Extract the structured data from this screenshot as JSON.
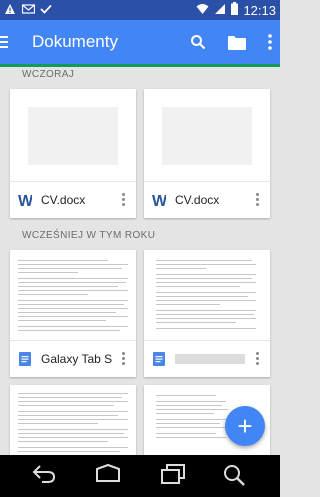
{
  "status_bar": {
    "time": "12:13",
    "icons": [
      "warning-icon",
      "gmail-icon",
      "check-icon",
      "wifi-icon",
      "signal-icon",
      "battery-icon"
    ]
  },
  "app_bar": {
    "title": "Dokumenty",
    "actions": [
      "search-icon",
      "folder-icon",
      "overflow-menu-icon"
    ]
  },
  "sections": [
    {
      "label": "WCZORAJ",
      "files": [
        {
          "name": "CV.docx",
          "type_icon": "word-doc-icon"
        },
        {
          "name": "CV.docx",
          "type_icon": "word-doc-icon"
        }
      ]
    },
    {
      "label": "WCZEŚNIEJ W TYM ROKU",
      "files": [
        {
          "name": "Galaxy Tab S",
          "type_icon": "google-doc-icon"
        },
        {
          "name": "",
          "type_icon": "google-doc-icon"
        }
      ]
    }
  ],
  "fab": {
    "label": "+"
  },
  "colors": {
    "status_bar": "#2b50a8",
    "app_bar": "#4285f4",
    "accent": "#0f9d58",
    "word_blue": "#2a5699",
    "gdoc_blue": "#4a86e8"
  }
}
